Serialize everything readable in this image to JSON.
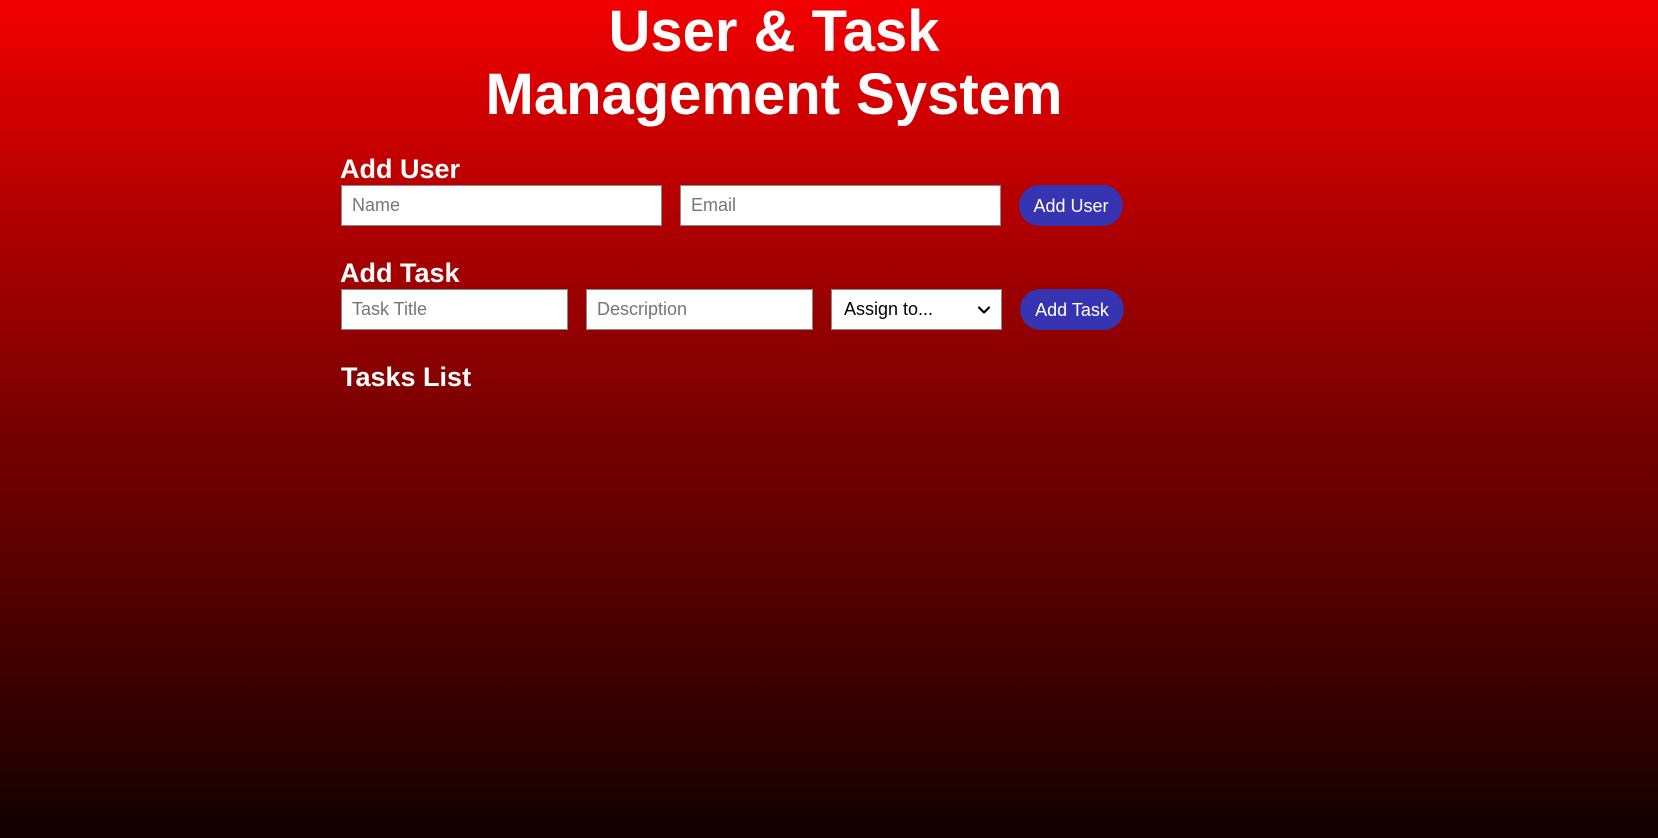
{
  "header": {
    "title_line1": "User & Task",
    "title_line2": "Management System"
  },
  "add_user": {
    "heading": "Add User",
    "name_placeholder": "Name",
    "email_placeholder": "Email",
    "button_label": "Add User"
  },
  "add_task": {
    "heading": "Add Task",
    "title_placeholder": "Task Title",
    "description_placeholder": "Description",
    "assign_selected": "Assign to...",
    "assign_icon": "chevron-down-icon",
    "button_label": "Add Task"
  },
  "tasks_list": {
    "heading": "Tasks List",
    "items": []
  },
  "colors": {
    "background_top": "#f20000",
    "background_bottom": "#120000",
    "button_accent": "#3634b0",
    "text": "#ffffff"
  }
}
